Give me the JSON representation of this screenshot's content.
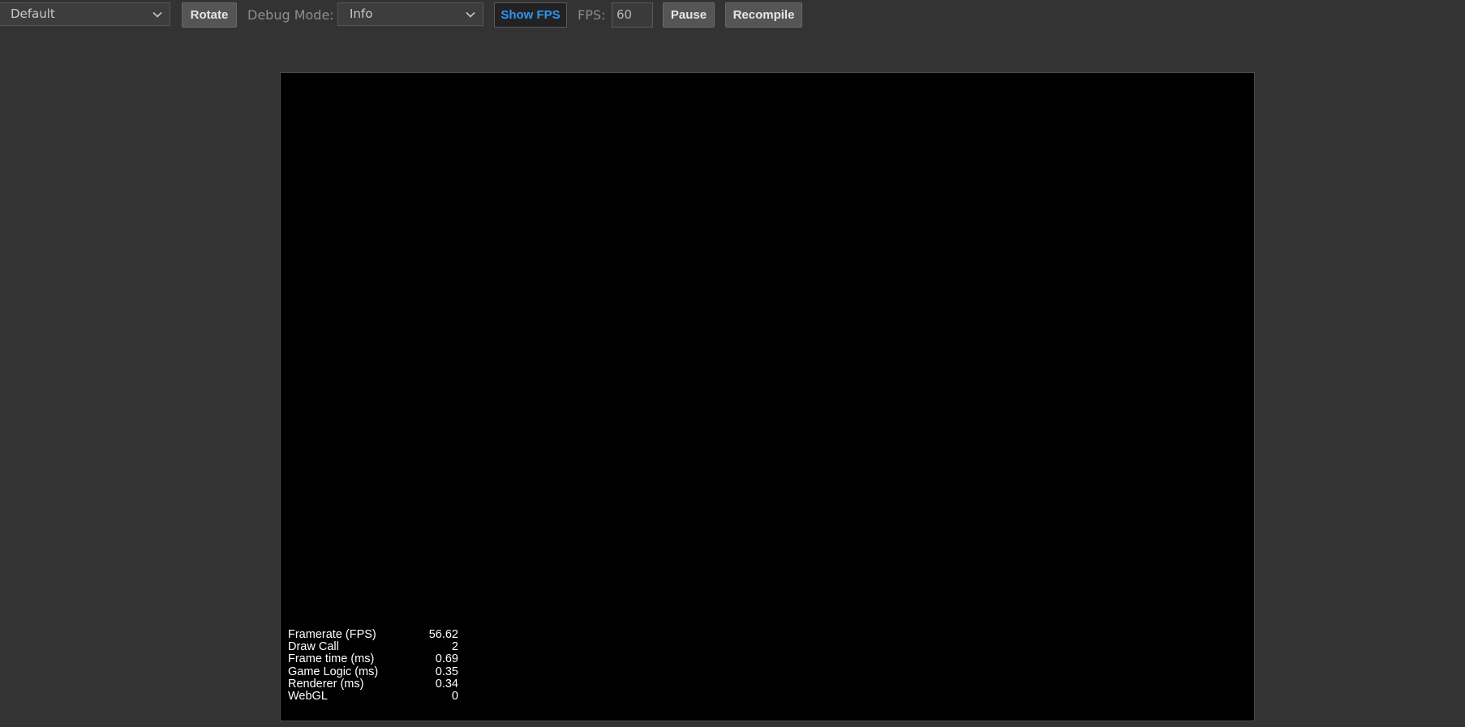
{
  "toolbar": {
    "scene_select": {
      "value": "Default"
    },
    "rotate_label": "Rotate",
    "debug_mode_label": "Debug Mode:",
    "debug_mode_select": {
      "value": "Info"
    },
    "show_fps_label": "Show FPS",
    "fps_label": "FPS:",
    "fps_value": "60",
    "pause_label": "Pause",
    "recompile_label": "Recompile"
  },
  "stats": [
    {
      "label": "Framerate (FPS)",
      "value": "56.62"
    },
    {
      "label": "Draw Call",
      "value": "2"
    },
    {
      "label": "Frame time (ms)",
      "value": "0.69"
    },
    {
      "label": "Game Logic (ms)",
      "value": "0.35"
    },
    {
      "label": "Renderer (ms)",
      "value": "0.34"
    },
    {
      "label": "WebGL",
      "value": "0"
    }
  ],
  "icons": {
    "select_arrow": "chevron-down-icon"
  },
  "colors": {
    "background": "#333333",
    "canvas": "#000000",
    "active_button_text": "#2e95f3"
  }
}
